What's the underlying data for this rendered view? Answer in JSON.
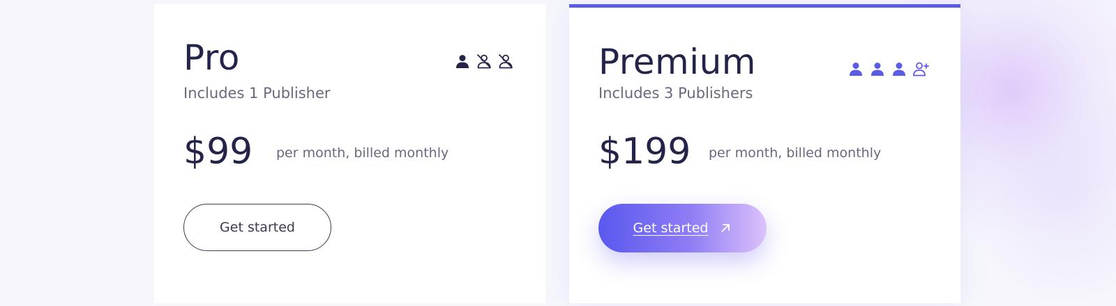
{
  "plans": [
    {
      "name": "Pro",
      "description": "Includes 1 Publisher",
      "price": "$99",
      "billing": "per month, billed monthly",
      "cta_label": "Get started",
      "publisher_icons": [
        "user-icon",
        "user-off-icon",
        "user-off-icon"
      ]
    },
    {
      "name": "Premium",
      "description": "Includes 3 Publishers",
      "price": "$199",
      "billing": "per month, billed monthly",
      "cta_label": "Get started",
      "cta_icon": "arrow-up-right-icon",
      "publisher_icons": [
        "user-icon",
        "user-icon",
        "user-icon",
        "user-plus-icon"
      ]
    }
  ],
  "colors": {
    "text": "#24244a",
    "muted": "#686880",
    "accent": "#5b5be8",
    "accent_gradient_end": "#dcc2fb",
    "background": "#f6f6fc",
    "card": "#ffffff"
  }
}
